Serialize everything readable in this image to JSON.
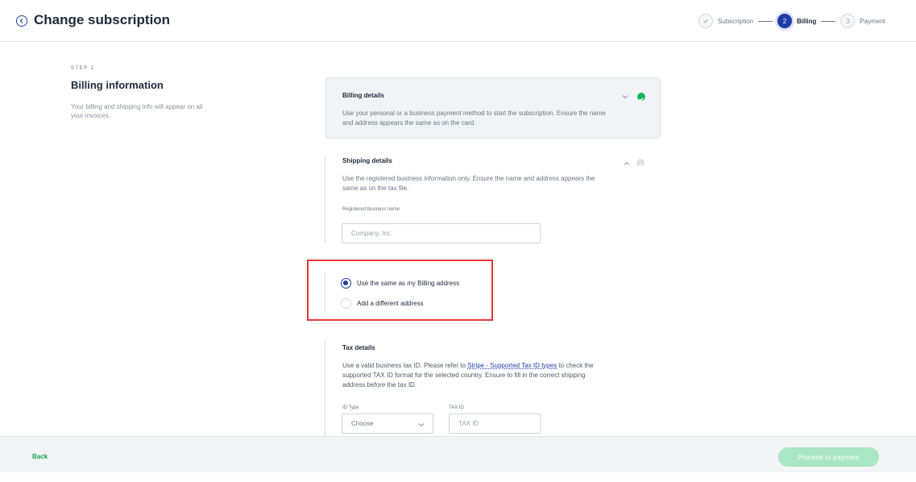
{
  "header": {
    "title": "Change subscription",
    "back_icon": "chevron-left-circle-icon",
    "stepper": [
      {
        "index": "",
        "label": "Subscription",
        "state": "done"
      },
      {
        "index": "2",
        "label": "Billing",
        "state": "active"
      },
      {
        "index": "3",
        "label": "Payment",
        "state": "todo"
      }
    ]
  },
  "left": {
    "step_label": "STEP 2",
    "title": "Billing information",
    "description": "Your billing and shipping info will appear on all your invoices."
  },
  "billing": {
    "title": "Billing details",
    "description": "Use your personal or a business payment method to start the subscription. Ensure the name and address appears the same as on the card.",
    "expanded": false,
    "complete": true
  },
  "shipping": {
    "title": "Shipping details",
    "description": "Use the registered business information only. Ensure the name and address appears the same as on the tax file.",
    "business_name_label": "Registered business name",
    "business_name_placeholder": "Company, Inc.",
    "expanded": true,
    "complete": false,
    "address_options": [
      {
        "label": "Use the same as my Billing address",
        "checked": true
      },
      {
        "label": "Add a different address",
        "checked": false
      }
    ]
  },
  "tax": {
    "title": "Tax details",
    "desc_before": "Use a valid business tax ID. Please refer to ",
    "link_text": "Stripe - Supported Tax ID types",
    "desc_after": " to check the supported TAX ID format for the selected country. Ensure to fill in the correct shipping address before the tax ID.",
    "id_type_label": "ID Type",
    "id_type_value": "Choose",
    "tax_id_label": "TAX ID",
    "tax_id_placeholder": "TAX ID"
  },
  "footer": {
    "back_label": "Back",
    "proceed_label": "Proceed to payment"
  },
  "colors": {
    "primary": "#1f3da8",
    "success": "#19b35a",
    "proceed_disabled": "#a9e6c3",
    "highlight": "#e53935"
  }
}
